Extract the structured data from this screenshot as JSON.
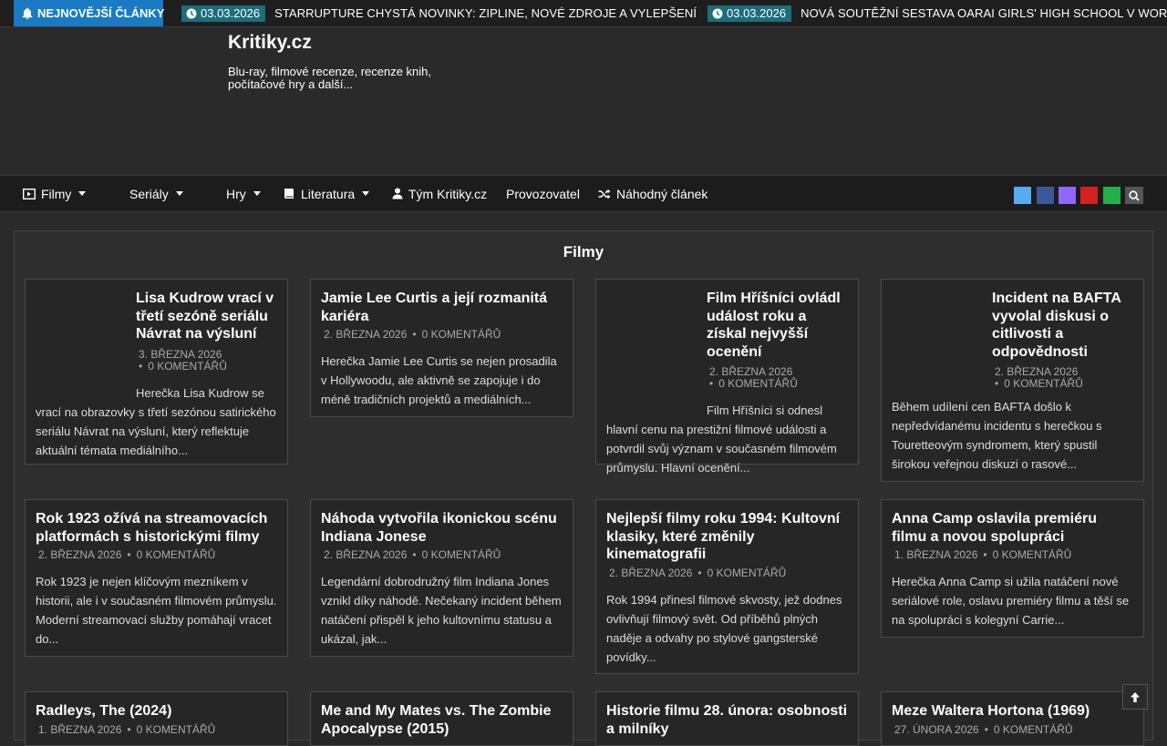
{
  "ticker": {
    "label": "NEJNOVĚJŠÍ ČLÁNKY",
    "items": [
      {
        "date": "03.03.2026",
        "title": "STARRUPTURE CHYSTÁ NOVINKY: ZIPLINE, NOVÉ ZDROJE A VYLEPŠENÍ"
      },
      {
        "date": "03.03.2026",
        "title": "NOVÁ SOUTĚŽNÍ SESTAVA OARAI GIRLS' HIGH SCHOOL V WORLD OF TANKS"
      }
    ]
  },
  "header": {
    "title": "Kritiky.cz",
    "description": "Blu-ray, filmové recenze, recenze knih, počítačové hry a další..."
  },
  "nav": {
    "items": [
      {
        "label": "Filmy",
        "icon": "film-icon",
        "dropdown": true
      },
      {
        "label": "Seriály",
        "icon": "",
        "dropdown": true
      },
      {
        "label": "Hry",
        "icon": "",
        "dropdown": true
      },
      {
        "label": "Literatura",
        "icon": "book-icon",
        "dropdown": true
      },
      {
        "label": "Tým Kritiky.cz",
        "icon": "user-icon",
        "dropdown": false
      },
      {
        "label": "Provozovatel",
        "icon": "",
        "dropdown": false
      },
      {
        "label": "Náhodný článek",
        "icon": "shuffle-icon",
        "dropdown": false
      }
    ],
    "social": [
      {
        "name": "twitter-icon",
        "color": "#55acee"
      },
      {
        "name": "facebook-icon",
        "color": "#3b5998"
      },
      {
        "name": "twitch-icon",
        "color": "#9166ff"
      },
      {
        "name": "youtube-icon",
        "color": "#d42020"
      },
      {
        "name": "rss-icon",
        "color": "#21b04a"
      }
    ]
  },
  "section": {
    "title": "Filmy",
    "cards": [
      {
        "title": "Lisa Kudrow vrací v třetí sezóně seriálu Návrat na výsluní",
        "date": "3. BŘEZNA 2026",
        "comments": "0 KOMENTÁŘŮ",
        "excerpt_first": "Herečka Lisa Kudrow se",
        "excerpt_rest": "vrací na obrazovky s třetí sezónou satirického seriálu Návrat na výsluní, který reflektuje aktuální témata mediálního..."
      },
      {
        "title": "Jamie Lee Curtis a její rozmanitá kariéra",
        "date": "2. BŘEZNA 2026",
        "comments": "0 KOMENTÁŘŮ",
        "excerpt": "Herečka Jamie Lee Curtis se nejen prosadila v Hollywoodu, ale aktivně se zapojuje i do méně tradičních projektů a mediálních..."
      },
      {
        "title": "Film Hříšníci ovládl událost roku a získal nejvyšší ocenění",
        "date": "2. BŘEZNA 2026",
        "comments": "0 KOMENTÁŘŮ",
        "excerpt_first": "Film Hříšníci si odnesl",
        "excerpt_rest": "hlavní cenu na prestižní filmové události a potvrdil svůj význam v současném filmovém průmyslu. Hlavní ocenění..."
      },
      {
        "title": "Incident na BAFTA vyvolal diskusi o citlivosti a odpovědnosti",
        "date": "2. BŘEZNA 2026",
        "comments": "0 KOMENTÁŘŮ",
        "excerpt": "Během udílení cen BAFTA došlo k nepředvídanému incidentu s herečkou s Touretteovým syndromem, který spustil širokou veřejnou diskuzi o rasové..."
      },
      {
        "title": "Rok 1923 ožívá na streamovacích platformách s historickými filmy",
        "date": "2. BŘEZNA 2026",
        "comments": "0 KOMENTÁŘŮ",
        "excerpt": "Rok 1923 je nejen klíčovým mezníkem v historii, ale i v současném filmovém průmyslu. Moderní streamovací služby pomáhají vracet do..."
      },
      {
        "title": "Náhoda vytvořila ikonickou scénu Indiana Jonese",
        "date": "2. BŘEZNA 2026",
        "comments": "0 KOMENTÁŘŮ",
        "excerpt": "Legendární dobrodružný film Indiana Jones vznikl díky náhodě. Nečekaný incident během natáčení přispěl k jeho kultovnímu statusu a ukázal, jak..."
      },
      {
        "title": "Nejlepší filmy roku 1994: Kultovní klasiky, které změnily kinematografii",
        "date": "2. BŘEZNA 2026",
        "comments": "0 KOMENTÁŘŮ",
        "excerpt": "Rok 1994 přinesl filmové skvosty, jež dodnes ovlivňují filmový svět. Od příběhů plných naděje a odvahy po stylové gangsterské povídky..."
      },
      {
        "title": "Anna Camp oslavila premiéru filmu a novou spolupráci",
        "date": "1. BŘEZNA 2026",
        "comments": "0 KOMENTÁŘŮ",
        "excerpt": "Herečka Anna Camp si užila natáčení nové seriálové role, oslavu premiéry filmu a těší se na spolupráci s kolegyní Carrie..."
      },
      {
        "title": "Radleys, The (2024)",
        "date": "1. BŘEZNA 2026",
        "comments": "0 KOMENTÁŘŮ",
        "excerpt": ""
      },
      {
        "title": "Me and My Mates vs. The Zombie Apocalypse (2015)",
        "date": "",
        "comments": "",
        "excerpt": ""
      },
      {
        "title": "Historie filmu 28. února: osobnosti a milníky",
        "date": "",
        "comments": "",
        "excerpt": ""
      },
      {
        "title": "Meze Waltera Hortona (1969)",
        "date": "27. ÚNORA 2026",
        "comments": "0 KOMENTÁŘŮ",
        "excerpt": ""
      }
    ]
  }
}
